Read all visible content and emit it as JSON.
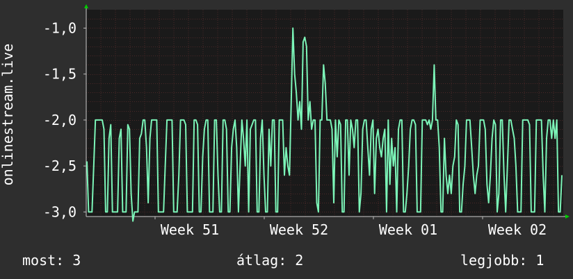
{
  "chart_data": {
    "type": "line",
    "ylabel": "onlinestream.live",
    "x_tick_labels": [
      "Week 51",
      "Week 52",
      "Week 01",
      "Week 02"
    ],
    "y_ticks": [
      -1.0,
      -1.5,
      -2.0,
      -2.5,
      -3.0
    ],
    "y_tick_labels": [
      "-1,0",
      "-1,5",
      "-2,0",
      "-2,5",
      "-3,0"
    ],
    "ylim": [
      -3.05,
      -0.8
    ],
    "grid": true,
    "colors": {
      "background": "#2e2e2e",
      "plot_background": "#1a1a1a",
      "grid": "#4a2828",
      "line": "#7cf5b8",
      "text": "#ffffff",
      "axis_arrow": "#00cc00"
    },
    "series": [
      {
        "values": [
          -2.45,
          -3.0,
          -3.0,
          -3.0,
          -2.5,
          -2.0,
          -2.0,
          -2.0,
          -2.0,
          -2.0,
          -2.1,
          -3.0,
          -3.0,
          -2.2,
          -2.05,
          -3.0,
          -3.0,
          -3.0,
          -3.0,
          -2.2,
          -2.1,
          -3.0,
          -3.0,
          -3.0,
          -2.05,
          -2.1,
          -2.8,
          -3.1,
          -3.0,
          -3.0,
          -3.0,
          -2.2,
          -2.15,
          -2.0,
          -2.0,
          -2.3,
          -2.9,
          -2.2,
          -2.0,
          -2.0,
          -2.0,
          -2.0,
          -3.0,
          -3.0,
          -3.0,
          -3.0,
          -2.5,
          -2.0,
          -2.0,
          -2.0,
          -2.0,
          -3.0,
          -3.0,
          -3.0,
          -2.6,
          -2.0,
          -2.0,
          -2.0,
          -2.05,
          -3.0,
          -3.0,
          -3.0,
          -3.0,
          -2.0,
          -2.0,
          -2.05,
          -3.0,
          -3.0,
          -2.4,
          -2.1,
          -2.0,
          -2.0,
          -3.0,
          -3.0,
          -3.0,
          -2.0,
          -2.0,
          -2.6,
          -3.0,
          -3.0,
          -2.0,
          -2.0,
          -2.1,
          -3.0,
          -3.0,
          -2.3,
          -2.1,
          -2.0,
          -2.3,
          -3.0,
          -2.5,
          -2.0,
          -2.2,
          -2.5,
          -2.0,
          -3.0,
          -2.1,
          -2.05,
          -2.0,
          -2.0,
          -3.0,
          -3.0,
          -2.2,
          -2.0,
          -2.6,
          -3.0,
          -3.0,
          -2.1,
          -2.5,
          -2.0,
          -2.0,
          -3.0,
          -3.0,
          -2.0,
          -2.0,
          -2.0,
          -2.6,
          -2.3,
          -2.5,
          -2.6,
          -1.8,
          -1.0,
          -1.5,
          -1.7,
          -2.0,
          -1.8,
          -2.1,
          -1.15,
          -1.1,
          -1.2,
          -2.0,
          -1.8,
          -2.1,
          -2.0,
          -2.0,
          -2.9,
          -3.0,
          -2.0,
          -2.0,
          -1.4,
          -1.6,
          -2.0,
          -2.0,
          -2.0,
          -2.1,
          -2.9,
          -2.0,
          -2.4,
          -2.0,
          -2.05,
          -3.0,
          -3.0,
          -2.0,
          -2.0,
          -2.6,
          -2.0,
          -2.1,
          -2.3,
          -2.0,
          -2.0,
          -3.0,
          -2.8,
          -2.1,
          -2.0,
          -2.0,
          -2.3,
          -2.6,
          -2.1,
          -2.0,
          -2.8,
          -2.2,
          -2.1,
          -2.3,
          -2.4,
          -2.2,
          -2.1,
          -3.0,
          -2.0,
          -2.7,
          -2.2,
          -2.5,
          -2.3,
          -3.0,
          -2.1,
          -2.0,
          -2.0,
          -3.0,
          -3.0,
          -2.8,
          -2.5,
          -2.1,
          -2.0,
          -2.0,
          -2.05,
          -3.0,
          -3.0,
          -3.0,
          -2.0,
          -2.0,
          -2.0,
          -2.05,
          -2.0,
          -2.1,
          -2.0,
          -1.4,
          -2.0,
          -2.0,
          -2.3,
          -3.0,
          -3.0,
          -2.2,
          -2.6,
          -2.8,
          -2.6,
          -2.8,
          -2.5,
          -2.4,
          -2.0,
          -2.05,
          -3.0,
          -3.0,
          -2.7,
          -2.5,
          -2.0,
          -2.0,
          -2.0,
          -2.3,
          -2.6,
          -2.8,
          -2.6,
          -2.5,
          -2.0,
          -2.0,
          -2.0,
          -2.1,
          -2.7,
          -2.9,
          -2.6,
          -2.2,
          -2.0,
          -2.05,
          -3.0,
          -2.8,
          -2.0,
          -2.0,
          -2.6,
          -3.0,
          -2.5,
          -2.0,
          -2.0,
          -2.1,
          -2.2,
          -2.5,
          -3.0,
          -3.0,
          -3.0,
          -2.0,
          -2.0,
          -2.0,
          -2.0,
          -2.05,
          -3.0,
          -3.0,
          -3.0,
          -2.0,
          -2.0,
          -2.0,
          -2.0,
          -2.6,
          -3.0,
          -2.2,
          -2.0,
          -2.0,
          -2.2,
          -2.0,
          -2.2,
          -2.0,
          -3.0,
          -3.0,
          -2.6
        ]
      }
    ]
  },
  "footer": {
    "current": "most: 3",
    "average": "átlag: 2",
    "best": "legjobb: 1"
  }
}
